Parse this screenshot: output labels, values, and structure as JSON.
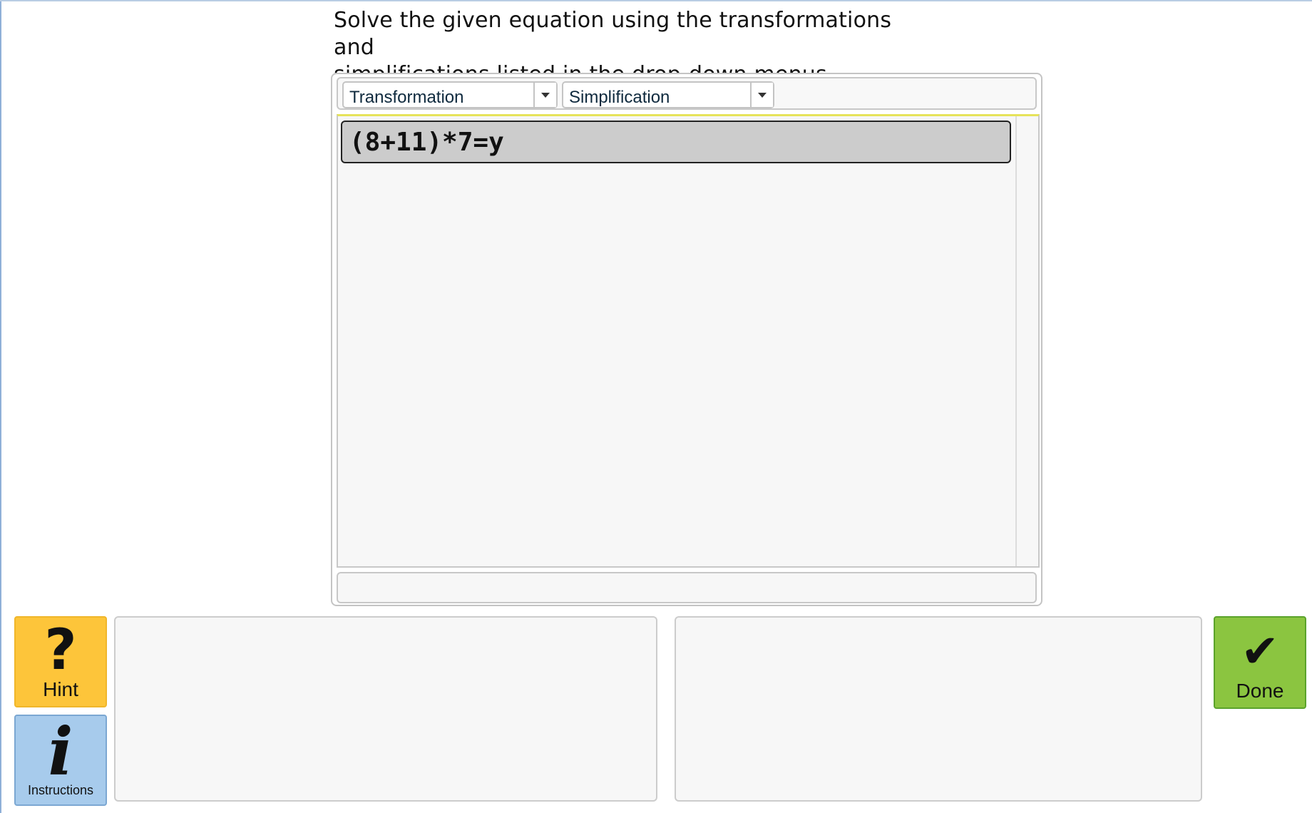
{
  "instructions": {
    "line1": "Solve the given equation using the transformations and",
    "line2": "simplifications listed in the drop-down menus."
  },
  "toolbar": {
    "transformation_label": "Transformation",
    "simplification_label": "Simplification"
  },
  "workspace": {
    "equations": [
      "(8+11)*7=y"
    ]
  },
  "buttons": {
    "hint_glyph": "?",
    "hint_label": "Hint",
    "instructions_glyph": "i",
    "instructions_label": "Instructions",
    "done_glyph": "✔",
    "done_label": "Done"
  },
  "colors": {
    "hint": "#fdc53a",
    "instructions": "#a7cbec",
    "done": "#8bc540",
    "workspace_highlight": "#e6e35a"
  },
  "icons": {
    "hint": "question-mark-icon",
    "instructions": "info-icon",
    "done": "checkmark-icon",
    "dropdown": "chevron-down-icon"
  }
}
